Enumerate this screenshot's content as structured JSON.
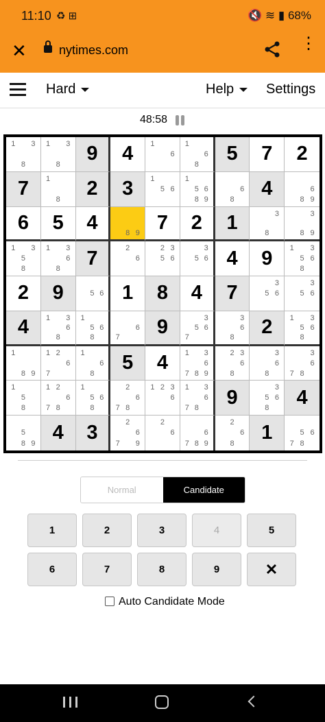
{
  "status": {
    "time": "11:10",
    "left_icons": "♻ ⊞",
    "battery": "68%",
    "right_icons": "🔇 ≋ ▮"
  },
  "browser": {
    "url": "nytimes.com"
  },
  "nav": {
    "difficulty": "Hard",
    "help": "Help",
    "settings": "Settings"
  },
  "timer": "48:58",
  "board": [
    [
      {
        "c": "1 3 8"
      },
      {
        "c": "1 3 8"
      },
      {
        "v": "9",
        "g": 1
      },
      {
        "v": "4"
      },
      {
        "c": "1 6"
      },
      {
        "c": "1 6 8"
      },
      {
        "v": "5",
        "g": 1
      },
      {
        "v": "7"
      },
      {
        "v": "2"
      }
    ],
    [
      {
        "v": "7",
        "g": 1
      },
      {
        "c": "1 8"
      },
      {
        "v": "2",
        "g": 1
      },
      {
        "v": "3",
        "g": 1
      },
      {
        "c": "1 5 6"
      },
      {
        "c": "1 5 6 8 9"
      },
      {
        "c": "6 8"
      },
      {
        "v": "4",
        "g": 1
      },
      {
        "c": "6 8 9"
      }
    ],
    [
      {
        "v": "6"
      },
      {
        "v": "5"
      },
      {
        "v": "4"
      },
      {
        "c": "8 9",
        "sel": 1
      },
      {
        "v": "7"
      },
      {
        "v": "2"
      },
      {
        "v": "1",
        "g": 1
      },
      {
        "c": "3 8"
      },
      {
        "c": "3 8 9"
      }
    ],
    [
      {
        "c": "1 3 5 8"
      },
      {
        "c": "1 3 6 8"
      },
      {
        "v": "7",
        "g": 1
      },
      {
        "c": "2 6"
      },
      {
        "c": "2 3 5 6"
      },
      {
        "c": "3 5 6"
      },
      {
        "v": "4"
      },
      {
        "v": "9"
      },
      {
        "c": "1 3 5 6 8"
      }
    ],
    [
      {
        "v": "2"
      },
      {
        "v": "9",
        "g": 1
      },
      {
        "c": "5 6"
      },
      {
        "v": "1"
      },
      {
        "v": "8",
        "g": 1
      },
      {
        "v": "4"
      },
      {
        "v": "7",
        "g": 1
      },
      {
        "c": "3 5 6"
      },
      {
        "c": "3 5 6"
      }
    ],
    [
      {
        "v": "4",
        "g": 1
      },
      {
        "c": "1 3 6 8"
      },
      {
        "c": "1 5 6 8"
      },
      {
        "c": "6 7"
      },
      {
        "v": "9",
        "g": 1
      },
      {
        "c": "3 5 6 7"
      },
      {
        "c": "3 6 8"
      },
      {
        "v": "2",
        "g": 1
      },
      {
        "c": "1 3 5 6 8"
      }
    ],
    [
      {
        "c": "1 8 9"
      },
      {
        "c": "1 2 6 7"
      },
      {
        "c": "1 6 8"
      },
      {
        "v": "5",
        "g": 1
      },
      {
        "v": "4"
      },
      {
        "c": "1 3 6 7 8 9"
      },
      {
        "c": "2 3 6 8"
      },
      {
        "c": "3 6 8"
      },
      {
        "c": "3 6 7 8"
      }
    ],
    [
      {
        "c": "1 5 8"
      },
      {
        "c": "1 2 6 7 8"
      },
      {
        "c": "1 5 6 8"
      },
      {
        "c": "2 6 7 8"
      },
      {
        "c": "1 2 3 6"
      },
      {
        "c": "1 3 6 7 8"
      },
      {
        "v": "9",
        "g": 1
      },
      {
        "c": "3 5 6 8"
      },
      {
        "v": "4",
        "g": 1
      }
    ],
    [
      {
        "c": "5 8 9"
      },
      {
        "v": "4",
        "g": 1
      },
      {
        "v": "3",
        "g": 1
      },
      {
        "c": "2 6 7 9"
      },
      {
        "c": "2 6"
      },
      {
        "c": "6 7 8 9"
      },
      {
        "c": "2 6 8"
      },
      {
        "v": "1",
        "g": 1
      },
      {
        "c": "5 6 7 8"
      }
    ]
  ],
  "mode": {
    "normal": "Normal",
    "candidate": "Candidate",
    "active": "Candidate"
  },
  "keypad": [
    "1",
    "2",
    "3",
    "4",
    "5",
    "6",
    "7",
    "8",
    "9",
    "✕"
  ],
  "keypad_disabled": [
    "4"
  ],
  "auto_candidate": {
    "label": "Auto Candidate Mode",
    "checked": false
  }
}
